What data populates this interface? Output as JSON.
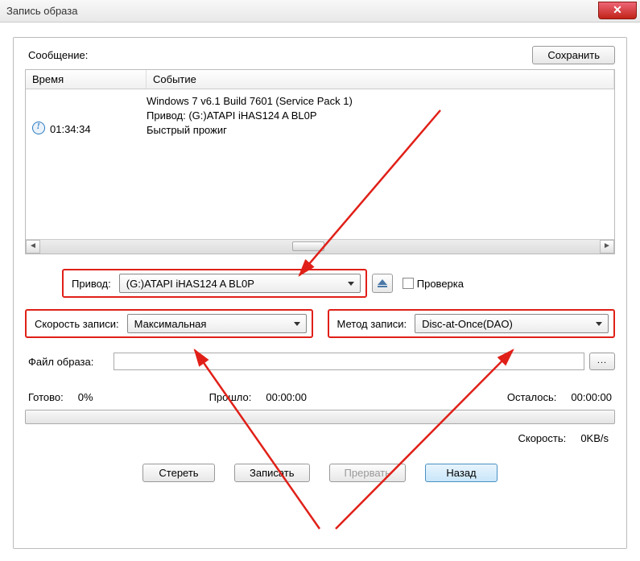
{
  "window": {
    "title": "Запись образа"
  },
  "buttons": {
    "save": "Сохранить",
    "erase": "Стереть",
    "burn": "Записать",
    "abort": "Прервать",
    "back": "Назад",
    "browse": "..."
  },
  "labels": {
    "message": "Сообщение:",
    "time_col": "Время",
    "event_col": "Событие",
    "drive": "Привод:",
    "verify": "Проверка",
    "write_speed": "Скорость записи:",
    "write_method": "Метод записи:",
    "image_file": "Файл образа:",
    "ready": "Готово:",
    "elapsed": "Прошло:",
    "remaining": "Осталось:",
    "speed": "Скорость:"
  },
  "log": {
    "time": "01:34:34",
    "line1": "Windows 7 v6.1 Build 7601 (Service Pack 1)",
    "line2": "Привод: (G:)ATAPI   iHAS124   A    BL0P",
    "line3": "Быстрый прожиг"
  },
  "values": {
    "drive": "(G:)ATAPI   iHAS124   A    BL0P",
    "write_speed": "Максимальная",
    "write_method": "Disc-at-Once(DAO)",
    "image_file": "",
    "ready_pct": "0%",
    "elapsed_time": "00:00:00",
    "remaining_time": "00:00:00",
    "speed": "0KB/s"
  }
}
